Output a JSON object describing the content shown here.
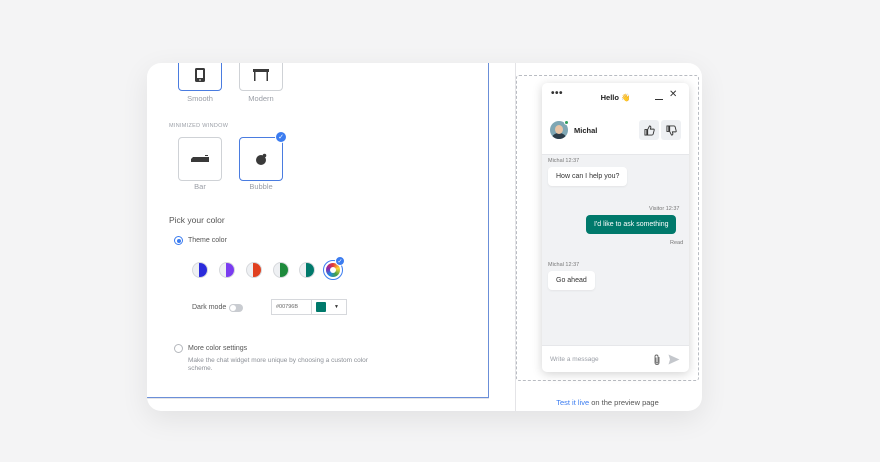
{
  "chat_window": {
    "style_options": [
      {
        "label": "Smooth",
        "selected": true
      },
      {
        "label": "Modern",
        "selected": false
      }
    ],
    "minimized_caption": "MINIMIZED WINDOW",
    "minimized_options": [
      {
        "label": "Bar",
        "selected": false
      },
      {
        "label": "Bubble",
        "selected": true
      }
    ]
  },
  "color": {
    "heading": "Pick your color",
    "theme_label": "Theme color",
    "swatches": [
      {
        "accent": "#2b2bdb"
      },
      {
        "accent": "#7a3cf0"
      },
      {
        "accent": "#e0401f"
      },
      {
        "accent": "#1e8a3c"
      },
      {
        "accent": "#00796B"
      }
    ],
    "dark_mode_label": "Dark mode",
    "dark_mode_on": false,
    "hex_value": "#00796B",
    "more_settings_label": "More color settings",
    "more_settings_desc": "Make the chat widget more unique by choosing a custom color scheme."
  },
  "preview": {
    "title": "Hello 👋",
    "agent_name": "Michal",
    "messages": [
      {
        "from": "agent",
        "meta": "Michal 12:37",
        "text": "How can I help you?"
      },
      {
        "from": "visitor",
        "meta": "Visitor 12:37",
        "text": "I'd like to ask something",
        "status": "Read"
      },
      {
        "from": "agent",
        "meta": "Michal 12:37",
        "text": "Go ahead"
      }
    ],
    "input_placeholder": "Write a message",
    "accent_color": "#00796B"
  },
  "test_live": {
    "link_text": "Test it live",
    "suffix": " on the preview page"
  }
}
